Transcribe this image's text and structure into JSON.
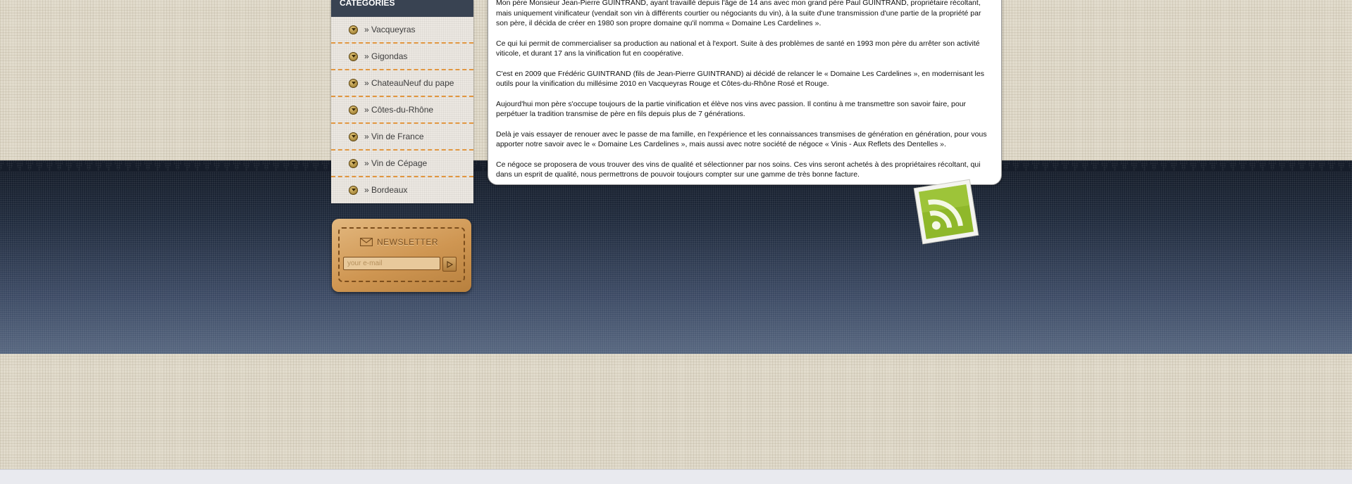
{
  "sidebar": {
    "title": "CATEGORIES",
    "items": [
      {
        "label": "» Vacqueyras",
        "icon": "circle-chevron-icon"
      },
      {
        "label": "» Gigondas",
        "icon": "circle-chevron-icon"
      },
      {
        "label": "» ChateauNeuf du pape",
        "icon": "circle-chevron-icon"
      },
      {
        "label": "» Côtes-du-Rhône",
        "icon": "circle-chevron-icon"
      },
      {
        "label": "» Vin de France",
        "icon": "circle-chevron-icon"
      },
      {
        "label": "» Vin de Cépage",
        "icon": "circle-chevron-icon"
      },
      {
        "label": "» Bordeaux",
        "icon": "circle-chevron-icon"
      }
    ]
  },
  "newsletter": {
    "title": "NEWSLETTER",
    "email_placeholder": "your e-mail",
    "icon": "envelope-icon",
    "submit_icon": "play-arrow-icon"
  },
  "content": {
    "paragraphs": [
      "Mon père Monsieur Jean-Pierre GUINTRAND, ayant travaillé depuis l'âge de 14 ans avec mon grand père Paul GUINTRAND, propriétaire récoltant, mais uniquement vinificateur (vendait son vin à différents courtier ou négociants du vin), à la suite d'une transmission d'une partie de la propriété par son père, il décida de créer en 1980 son propre domaine qu'il nomma « Domaine Les Cardelines ».",
      "Ce qui lui permit de commercialiser sa production au national et à l'export. Suite à des problèmes de santé en 1993 mon père du arrêter son activité viticole, et durant 17 ans la vinification fut en coopérative.",
      "C'est en 2009 que Frédéric GUINTRAND (fils de Jean-Pierre GUINTRAND) ai décidé de relancer le « Domaine Les Cardelines », en modernisant les outils pour la vinification du millésime 2010 en Vacqueyras Rouge et Côtes-du-Rhône Rosé et Rouge.",
      "Aujourd'hui mon père s'occupe toujours de la partie vinification et élève nos vins avec passion. Il continu à me transmettre son savoir faire, pour perpétuer la tradition transmise de père en fils depuis plus de 7 générations.",
      "Delà je vais essayer de renouer avec le passe de ma famille, en l'expérience et les connaissances transmises de génération en génération, pour vous apporter notre savoir avec le « Domaine Les Cardelines », mais aussi avec notre société de négoce « Vinis - Aux Reflets des Dentelles ».",
      "Ce négoce se proposera de vous trouver des vins de qualité et sélectionner par nos soins. Ces vins seront achetés à des propriétaires récoltant, qui dans un esprit de qualité, nous permettrons de pouvoir toujours compter sur une gamme de très bonne facture."
    ]
  },
  "rss": {
    "icon": "rss-feed-icon",
    "color": "#8fb82a"
  },
  "colors": {
    "page_bg": "#e2dccd",
    "sidebar_header": "#394352",
    "dashed_separator": "#e1963f",
    "band_top": "#131a26",
    "band_bottom": "#56667f"
  }
}
